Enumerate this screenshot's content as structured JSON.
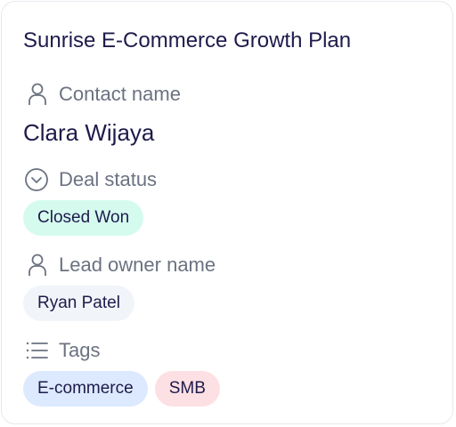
{
  "card": {
    "title": "Sunrise E-Commerce Growth Plan",
    "fields": {
      "contact": {
        "label": "Contact name",
        "icon": "person-icon",
        "value": "Clara Wijaya"
      },
      "deal_status": {
        "label": "Deal status",
        "icon": "chevron-circle-icon",
        "value": "Closed Won",
        "color": "#d5fbef"
      },
      "lead_owner": {
        "label": "Lead owner name",
        "icon": "person-icon",
        "value": "Ryan Patel"
      },
      "tags": {
        "label": "Tags",
        "icon": "list-icon",
        "items": [
          {
            "label": "E-commerce",
            "color": "#dce9ff"
          },
          {
            "label": "SMB",
            "color": "#fde0e3"
          }
        ]
      }
    }
  },
  "colors": {
    "title": "#1e1b4b",
    "label": "#6b7280",
    "border": "#e6e8ee"
  }
}
